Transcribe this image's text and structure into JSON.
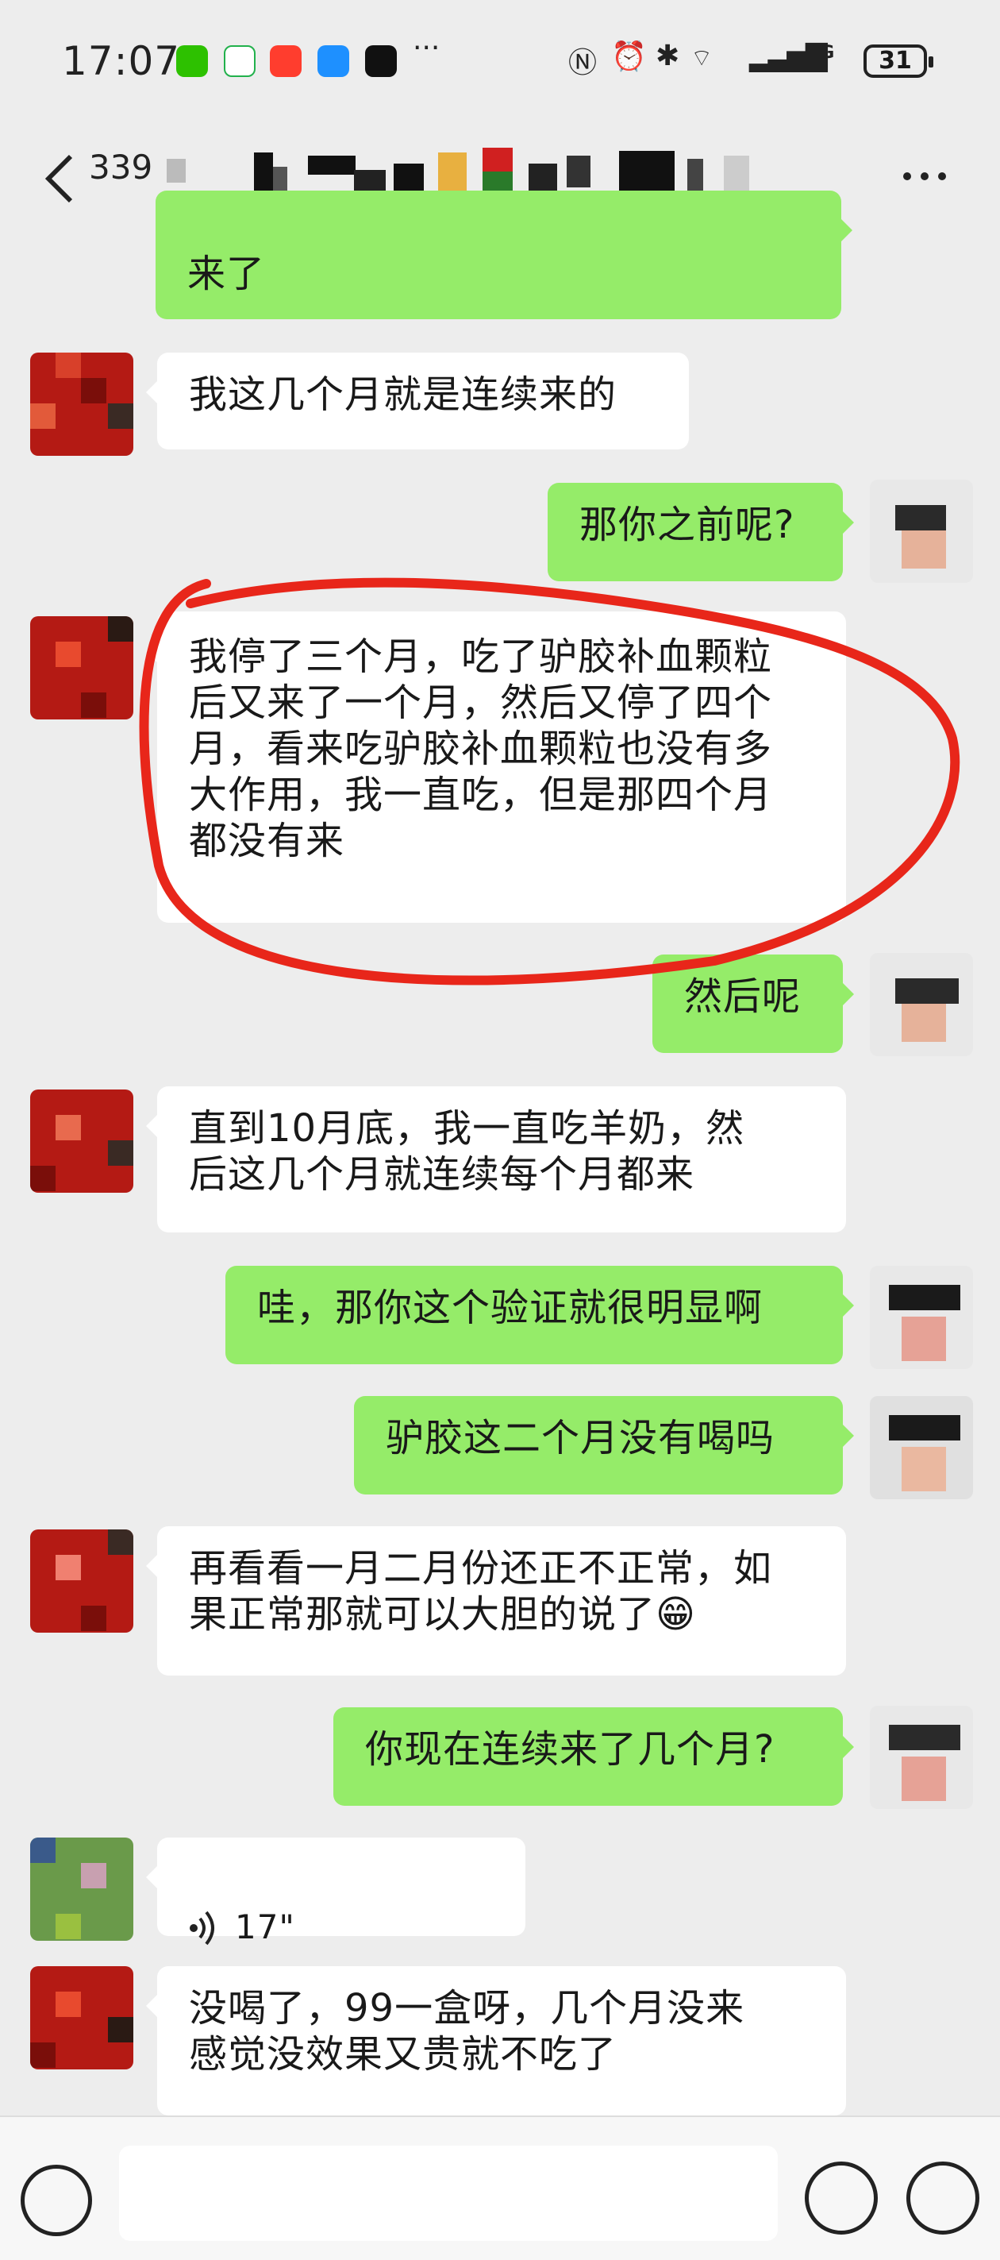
{
  "status": {
    "time": "17:07",
    "battery": "31",
    "network": "4G"
  },
  "header": {
    "title": "339"
  },
  "messages": [
    {
      "side": "right",
      "text": "来了"
    },
    {
      "side": "left",
      "text": "我这几个月就是连续来的"
    },
    {
      "side": "right",
      "text": "那你之前呢?"
    },
    {
      "side": "left",
      "text": "我停了三个月，吃了驴胶补血颗粒\n后又来了一个月，然后又停了四个\n月，看来吃驴胶补血颗粒也没有多\n大作用，我一直吃，但是那四个月\n都没有来"
    },
    {
      "side": "right",
      "text": "然后呢"
    },
    {
      "side": "left",
      "text": "直到10月底，我一直吃羊奶，然\n后这几个月就连续每个月都来"
    },
    {
      "side": "right",
      "text": "哇，那你这个验证就很明显啊"
    },
    {
      "side": "right",
      "text": "驴胶这二个月没有喝吗"
    },
    {
      "side": "left",
      "text": "再看看一月二月份还正不正常，如\n果正常那就可以大胆的说了😁"
    },
    {
      "side": "right",
      "text": "你现在连续来了几个月?"
    },
    {
      "side": "left",
      "voice": "17\""
    },
    {
      "side": "left",
      "text": "没喝了，99一盒呀，几个月没来\n感觉没效果又贵就不吃了"
    }
  ],
  "colors": {
    "accent": "#95ec69",
    "annotation": "#e8261a"
  }
}
